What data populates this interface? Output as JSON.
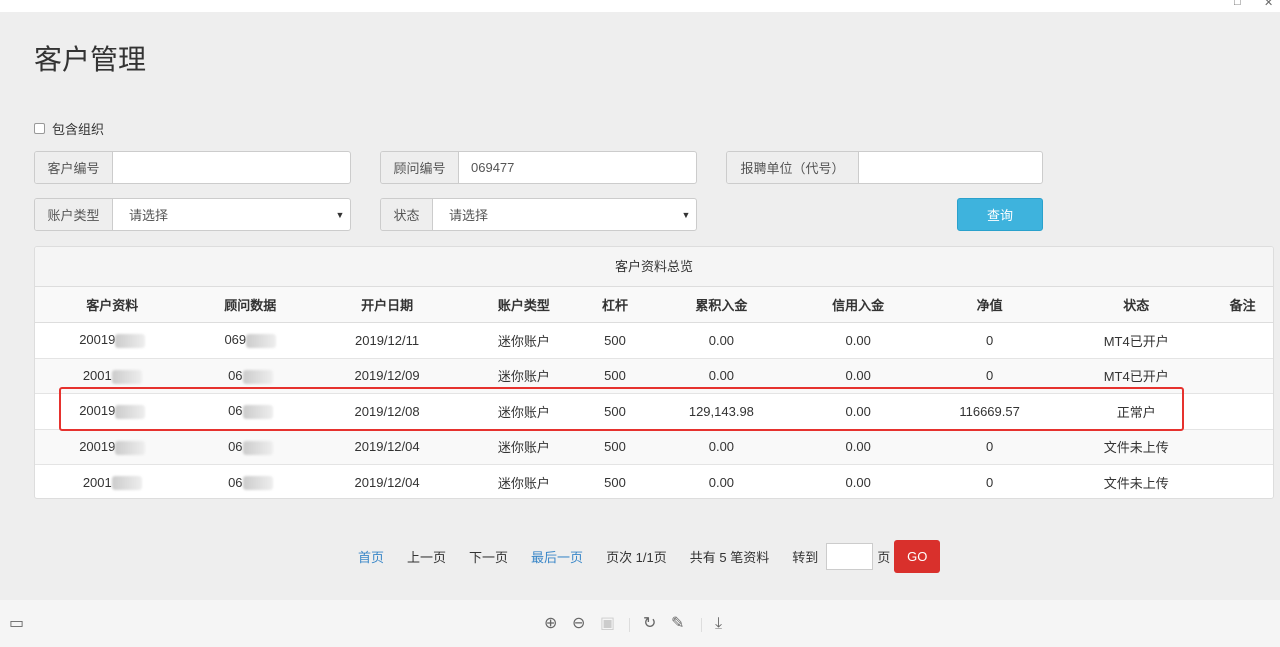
{
  "title": "客户管理",
  "include_org": "包含组织",
  "filters": {
    "customer_no_label": "客户编号",
    "customer_no_value": "",
    "advisor_no_label": "顾问编号",
    "advisor_no_value": "069477",
    "unit_label": "报聘单位（代号）",
    "unit_value": "",
    "account_type_label": "账户类型",
    "account_type_value": "请选择",
    "status_label": "状态",
    "status_value": "请选择",
    "query_button": "查询"
  },
  "panel_title": "客户资料总览",
  "columns": [
    "客户资料",
    "顾问数据",
    "开户日期",
    "账户类型",
    "杠杆",
    "累积入金",
    "信用入金",
    "净值",
    "状态",
    "备注"
  ],
  "rows": [
    [
      "20019",
      "069",
      "2019/12/11",
      "迷你账户",
      "500",
      "0.00",
      "0.00",
      "0",
      "MT4已开户",
      ""
    ],
    [
      "2001",
      "06",
      "2019/12/09",
      "迷你账户",
      "500",
      "0.00",
      "0.00",
      "0",
      "MT4已开户",
      ""
    ],
    [
      "20019",
      "06",
      "2019/12/08",
      "迷你账户",
      "500",
      "129,143.98",
      "0.00",
      "116669.57",
      "正常户",
      ""
    ],
    [
      "20019",
      "06",
      "2019/12/04",
      "迷你账户",
      "500",
      "0.00",
      "0.00",
      "0",
      "文件未上传",
      ""
    ],
    [
      "2001",
      "06",
      "2019/12/04",
      "迷你账户",
      "500",
      "0.00",
      "0.00",
      "0",
      "文件未上传",
      ""
    ]
  ],
  "pager": {
    "first": "首页",
    "prev": "上一页",
    "next": "下一页",
    "last": "最后一页",
    "page_info": "页次 1/1页",
    "total": "共有 5 笔资料",
    "goto": "转到",
    "page_unit": "页",
    "go": "GO"
  }
}
